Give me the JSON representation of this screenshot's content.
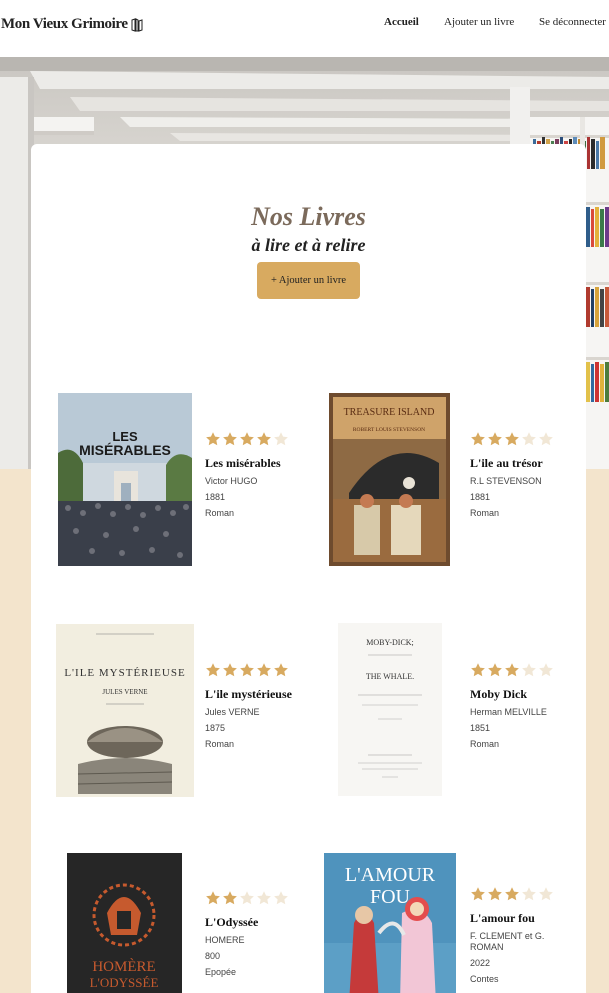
{
  "header": {
    "logo": "Mon Vieux Grimoire",
    "nav": {
      "home": "Accueil",
      "add": "Ajouter un livre",
      "logout": "Se déconnecter"
    }
  },
  "main": {
    "title": "Nos Livres",
    "subtitle": "à lire et à relire",
    "add_button": "+ Ajouter un livre"
  },
  "colors": {
    "accent": "#d8aa60",
    "title": "#7b6a5b",
    "page_bg": "#f3e4cc"
  },
  "books": [
    {
      "title": "Les misérables",
      "author": "Victor HUGO",
      "year": "1881",
      "genre": "Roman",
      "rating": 4,
      "cover_text": [
        "LES",
        "MISÉRABLES"
      ]
    },
    {
      "title": "L'ile au trésor",
      "author": "R.L STEVENSON",
      "year": "1881",
      "genre": "Roman",
      "rating": 3,
      "cover_text": [
        "TREASURE ISLAND",
        "ROBERT LOUIS STEVENSON"
      ]
    },
    {
      "title": "L'ile mystérieuse",
      "author": "Jules VERNE",
      "year": "1875",
      "genre": "Roman",
      "rating": 5,
      "cover_text": [
        "L'ILE MYSTÉRIEUSE",
        "JULES VERNE"
      ]
    },
    {
      "title": "Moby Dick",
      "author": "Herman MELVILLE",
      "year": "1851",
      "genre": "Roman",
      "rating": 3,
      "cover_text": [
        "MOBY-DICK;",
        "THE WHALE."
      ]
    },
    {
      "title": "L'Odyssée",
      "author": "HOMERE",
      "year": "800",
      "genre": "Epopée",
      "rating": 2,
      "cover_text": [
        "HOMÈRE",
        "L'ODYSSÉE"
      ]
    },
    {
      "title": "L'amour fou",
      "author": "F. CLEMENT et G. ROMAN",
      "year": "2022",
      "genre": "Contes",
      "rating": 3,
      "cover_text": [
        "L'AMOUR",
        "FOU"
      ]
    }
  ]
}
